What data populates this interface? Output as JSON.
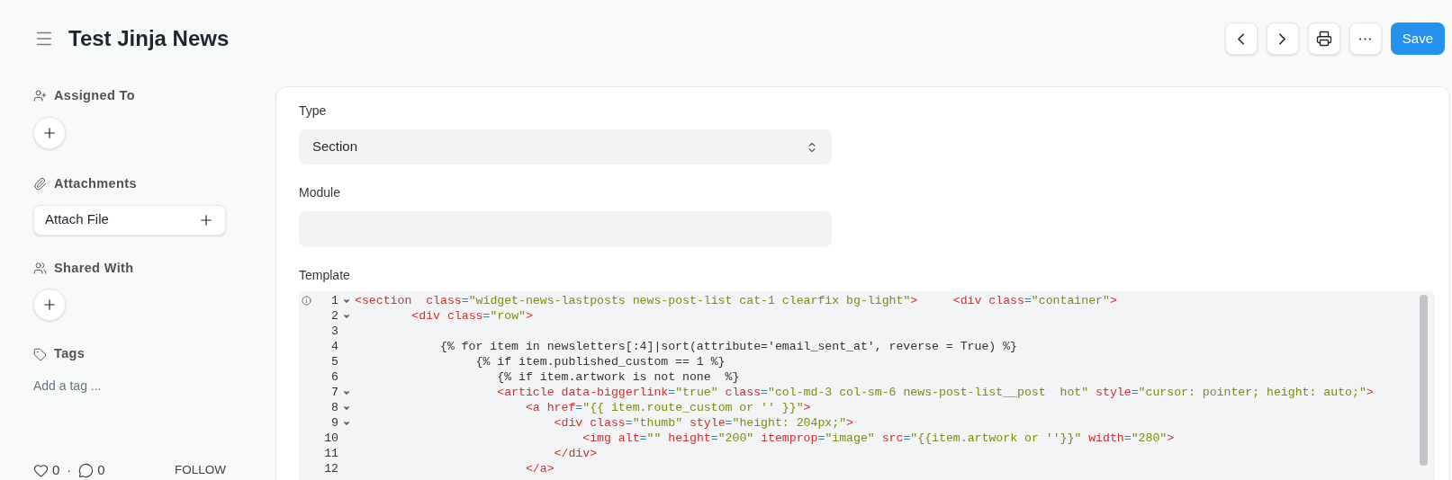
{
  "header": {
    "title": "Test Jinja News",
    "buttons": [
      {
        "kind": "prev"
      },
      {
        "kind": "next"
      },
      {
        "kind": "print"
      },
      {
        "kind": "more"
      }
    ],
    "save": "Save"
  },
  "sidebar": {
    "assigned_to": "Assigned To",
    "attachments": "Attachments",
    "attach_file": "Attach File",
    "shared_with": "Shared With",
    "tags": "Tags",
    "tag_placeholder": "Add a tag ...",
    "likes": "0",
    "separator": "·",
    "comments": "0",
    "follow": "FOLLOW"
  },
  "form": {
    "type": {
      "label": "Type",
      "value": "Section"
    },
    "module": {
      "label": "Module"
    },
    "template": {
      "label": "Template",
      "lines": [
        {
          "number": "1",
          "foldable": true,
          "tokens": [
            {
              "kind": "tag",
              "text": "<section  "
            },
            {
              "kind": "attr",
              "text": "class"
            },
            {
              "kind": "op",
              "text": "="
            },
            {
              "kind": "string",
              "text": "\"widget-news-lastposts news-post-list cat-1 clearfix bg-light\""
            },
            {
              "kind": "tag",
              "text": ">"
            },
            {
              "kind": "tag",
              "text": "     <div "
            },
            {
              "kind": "attr",
              "text": "class"
            },
            {
              "kind": "op",
              "text": "="
            },
            {
              "kind": "string",
              "text": "\"container\""
            },
            {
              "kind": "tag",
              "text": ">"
            }
          ]
        },
        {
          "number": "2",
          "foldable": true,
          "tokens": [
            {
              "kind": "tag",
              "text": "        <div "
            },
            {
              "kind": "attr",
              "text": "class"
            },
            {
              "kind": "op",
              "text": "="
            },
            {
              "kind": "string",
              "text": "\"row\""
            },
            {
              "kind": "tag",
              "text": ">"
            }
          ]
        },
        {
          "number": "3",
          "foldable": false
        },
        {
          "number": "4",
          "foldable": false,
          "tokens": [
            {
              "kind": "text",
              "text": "            {% for item in newsletters[:4]|sort(attribute='email_sent_at', reverse = True) %}"
            }
          ]
        },
        {
          "number": "5",
          "foldable": false,
          "tokens": [
            {
              "kind": "text",
              "text": "                 {% if item.published_custom == 1 %}"
            }
          ]
        },
        {
          "number": "6",
          "foldable": false,
          "tokens": [
            {
              "kind": "text",
              "text": "                    {% if item.artwork is not none  %}"
            }
          ]
        },
        {
          "number": "7",
          "foldable": true,
          "tokens": [
            {
              "kind": "tag",
              "text": "                    <article "
            },
            {
              "kind": "attr",
              "text": "data-biggerlink"
            },
            {
              "kind": "op",
              "text": "="
            },
            {
              "kind": "string",
              "text": "\"true\""
            },
            {
              "kind": "attr",
              "text": " class"
            },
            {
              "kind": "op",
              "text": "="
            },
            {
              "kind": "string",
              "text": "\"col-md-3 col-sm-6 news-post-list__post  hot\""
            },
            {
              "kind": "attr",
              "text": " style"
            },
            {
              "kind": "op",
              "text": "="
            },
            {
              "kind": "string",
              "text": "\"cursor: pointer; height: auto;\""
            },
            {
              "kind": "tag",
              "text": ">"
            }
          ]
        },
        {
          "number": "8",
          "foldable": true,
          "tokens": [
            {
              "kind": "tag",
              "text": "                        <a "
            },
            {
              "kind": "attr",
              "text": "href"
            },
            {
              "kind": "op",
              "text": "="
            },
            {
              "kind": "string",
              "text": "\"{{ item.route_custom or '' }}\""
            },
            {
              "kind": "tag",
              "text": ">"
            }
          ]
        },
        {
          "number": "9",
          "foldable": true,
          "tokens": [
            {
              "kind": "tag",
              "text": "                            <div "
            },
            {
              "kind": "attr",
              "text": "class"
            },
            {
              "kind": "op",
              "text": "="
            },
            {
              "kind": "string",
              "text": "\"thumb\""
            },
            {
              "kind": "attr",
              "text": " style"
            },
            {
              "kind": "op",
              "text": "="
            },
            {
              "kind": "string",
              "text": "\"height: 204px;\""
            },
            {
              "kind": "tag",
              "text": ">"
            }
          ]
        },
        {
          "number": "10",
          "foldable": false,
          "tokens": [
            {
              "kind": "tag",
              "text": "                                <img "
            },
            {
              "kind": "attr",
              "text": "alt"
            },
            {
              "kind": "op",
              "text": "="
            },
            {
              "kind": "string",
              "text": "\"\""
            },
            {
              "kind": "attr",
              "text": " height"
            },
            {
              "kind": "op",
              "text": "="
            },
            {
              "kind": "string",
              "text": "\"200\""
            },
            {
              "kind": "attr",
              "text": " itemprop"
            },
            {
              "kind": "op",
              "text": "="
            },
            {
              "kind": "string",
              "text": "\"image\""
            },
            {
              "kind": "attr",
              "text": " src"
            },
            {
              "kind": "op",
              "text": "="
            },
            {
              "kind": "string",
              "text": "\"{{item.artwork or ''}}\""
            },
            {
              "kind": "attr",
              "text": " width"
            },
            {
              "kind": "op",
              "text": "="
            },
            {
              "kind": "string",
              "text": "\"280\""
            },
            {
              "kind": "tag",
              "text": ">"
            }
          ]
        },
        {
          "number": "11",
          "foldable": false,
          "tokens": [
            {
              "kind": "tag",
              "text": "                            </div>"
            }
          ]
        },
        {
          "number": "12",
          "foldable": false,
          "tokens": [
            {
              "kind": "tag",
              "text": "                        </a>"
            }
          ]
        }
      ]
    }
  }
}
